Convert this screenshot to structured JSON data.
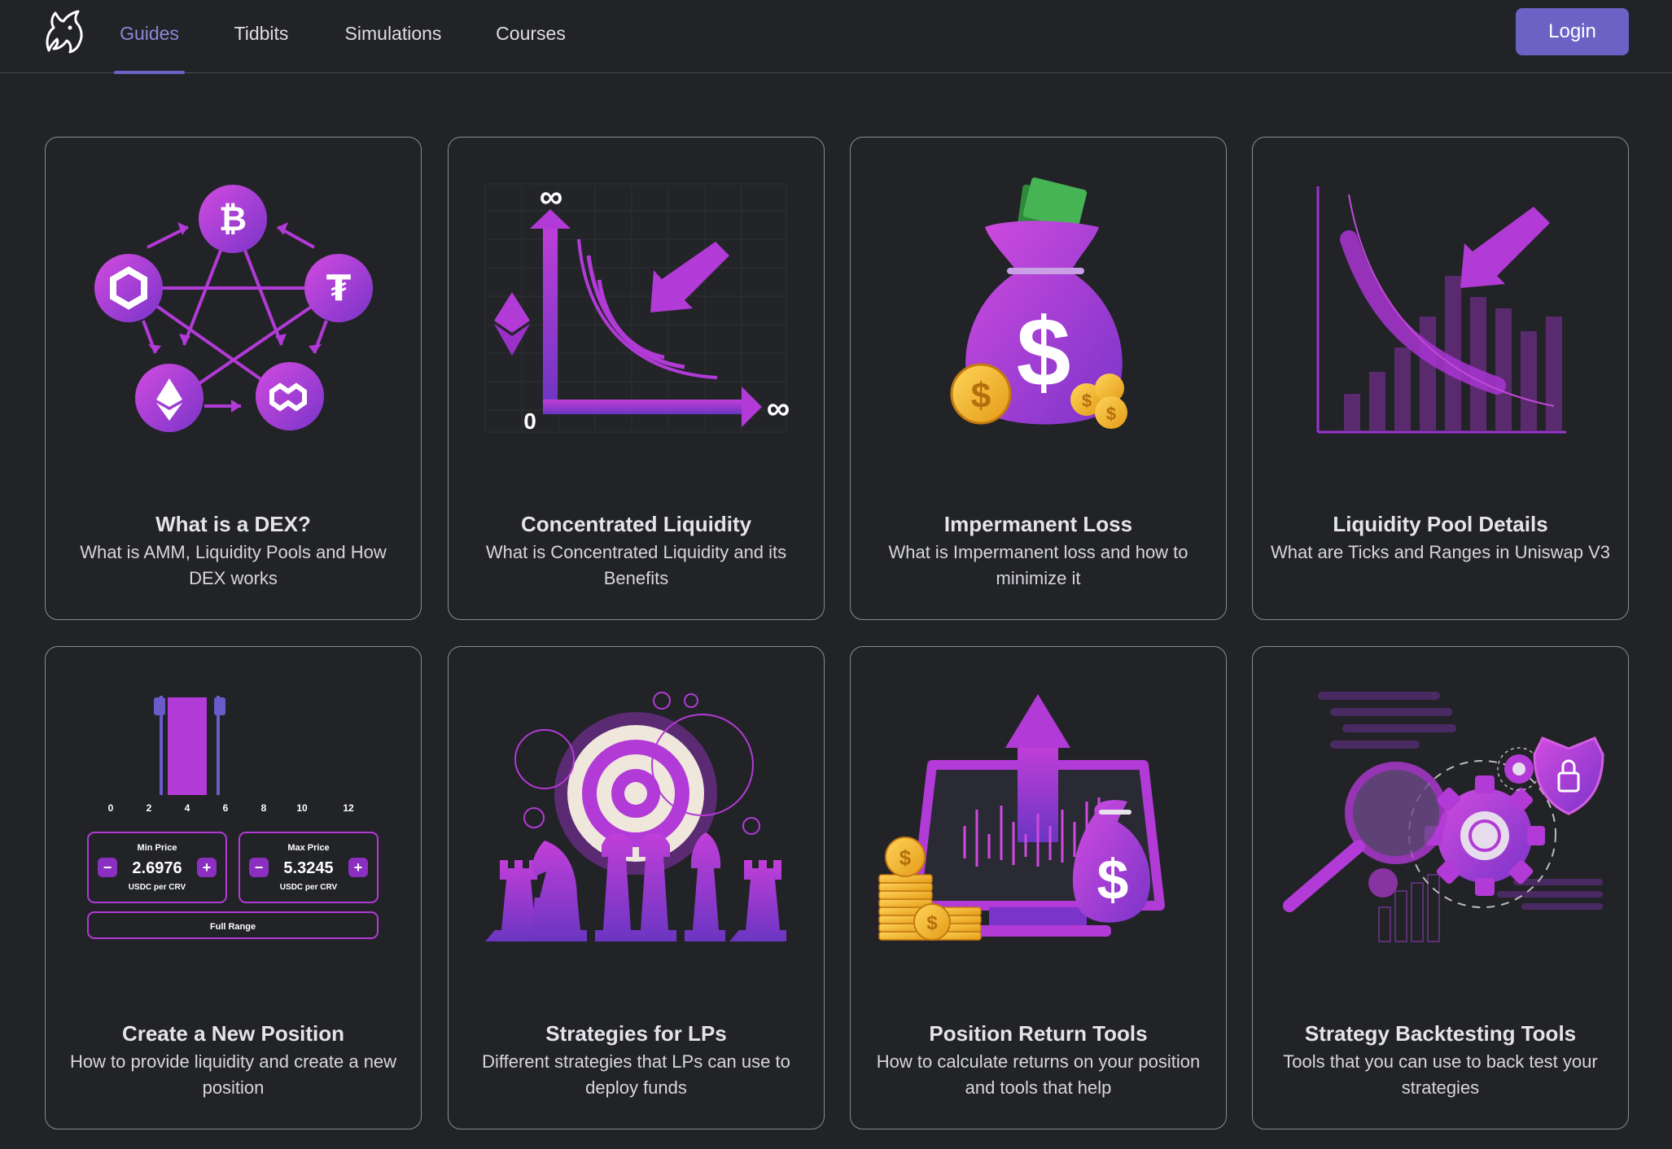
{
  "nav": {
    "logo": "uniswap-unicorn-logo",
    "tabs": [
      {
        "label": "Guides",
        "active": true
      },
      {
        "label": "Tidbits",
        "active": false
      },
      {
        "label": "Simulations",
        "active": false
      },
      {
        "label": "Courses",
        "active": false
      }
    ],
    "login_label": "Login"
  },
  "colors": {
    "accent": "#6a62c4",
    "active_tab": "#8d86dc",
    "background": "#222327",
    "illustration_purple": "#b23ad6"
  },
  "cards": [
    {
      "title": "What is a DEX?",
      "description": "What is AMM, Liquidity Pools and How DEX works",
      "illustration": "crypto-network-icon"
    },
    {
      "title": "Concentrated Liquidity",
      "description": "What is Concentrated Liquidity and its Benefits",
      "illustration": "liquidity-curve-icon",
      "art": {
        "zero": "0",
        "inf": "∞"
      }
    },
    {
      "title": "Impermanent Loss",
      "description": "What is Impermanent loss and how to minimize it",
      "illustration": "money-bag-icon",
      "art": {
        "dollar": "$"
      }
    },
    {
      "title": "Liquidity Pool Details",
      "description": "What are Ticks and Ranges in Uniswap V3",
      "illustration": "tick-bars-chart-icon"
    },
    {
      "title": "Create a New Position",
      "description": "How to provide liquidity and create a new position",
      "illustration": "price-range-widget",
      "art": {
        "ticks": [
          "0",
          "2",
          "4",
          "6",
          "8",
          "10",
          "12"
        ],
        "min_label": "Min Price",
        "min_value": "2.6976",
        "max_label": "Max Price",
        "max_value": "5.3245",
        "unit": "USDC per CRV",
        "full_range": "Full Range",
        "minus": "−",
        "plus": "+"
      }
    },
    {
      "title": "Strategies for LPs",
      "description": "Different strategies that LPs can use to deploy funds",
      "illustration": "chess-target-icon"
    },
    {
      "title": "Position Return Tools",
      "description": "How to calculate returns on your position and tools that help",
      "illustration": "monitor-growth-icon",
      "art": {
        "dollar": "$"
      }
    },
    {
      "title": "Strategy Backtesting Tools",
      "description": "Tools that you can use to back test your strategies",
      "illustration": "magnifier-gears-icon"
    }
  ]
}
